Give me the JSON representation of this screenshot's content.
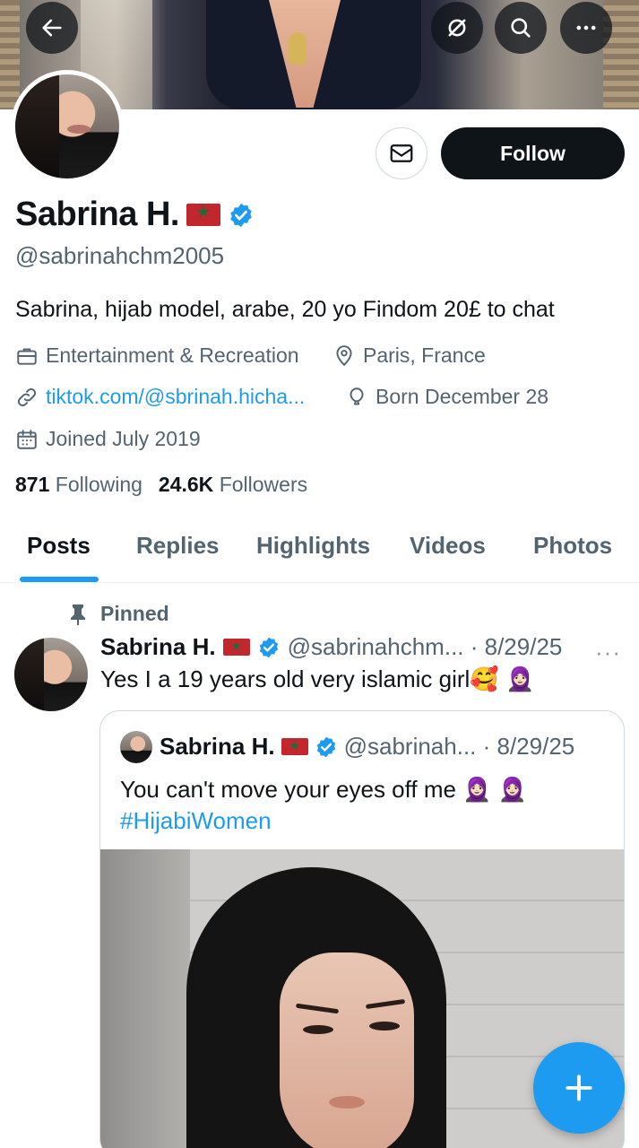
{
  "header": {
    "back_icon": "arrow-left-icon",
    "grok_icon": "slash-circle-icon",
    "search_icon": "search-icon",
    "more_icon": "more-horizontal-icon"
  },
  "profile": {
    "name": "Sabrina H.",
    "flag": "🇲🇦",
    "verified": true,
    "handle": "@sabrinahchm2005",
    "bio": "Sabrina, hijab model, arabe, 20 yo Findom 20£ to chat",
    "category": "Entertainment & Recreation",
    "location": "Paris, France",
    "website": "tiktok.com/@sbrinah.hicha...",
    "birthday": "Born December 28",
    "joined": "Joined July 2019",
    "following_count": "871",
    "following_label": "Following",
    "followers_count": "24.6K",
    "followers_label": "Followers",
    "follow_label": "Follow",
    "message_icon": "envelope-icon"
  },
  "tabs": [
    {
      "label": "Posts",
      "active": true
    },
    {
      "label": "Replies",
      "active": false
    },
    {
      "label": "Highlights",
      "active": false
    },
    {
      "label": "Videos",
      "active": false
    },
    {
      "label": "Photos",
      "active": false
    }
  ],
  "pinned_post": {
    "pinned_label": "Pinned",
    "name": "Sabrina H.",
    "handle_date": "@sabrinahchm... · 8/29/25",
    "more": "···",
    "text": "Yes I a 19 years old very islamic girl",
    "emojis": [
      "🥰",
      "🧕🏻"
    ],
    "quote": {
      "name": "Sabrina H.",
      "handle_date": "@sabrinah... · 8/29/25",
      "text": "You can't move your eyes off me",
      "emojis": [
        "🧕🏻",
        "🧕🏻"
      ],
      "hashtag": "#HijabiWomen"
    }
  },
  "fab": {
    "icon": "plus-icon"
  },
  "colors": {
    "accent": "#1d9bf0",
    "text": "#0f1419",
    "muted": "#536471"
  }
}
